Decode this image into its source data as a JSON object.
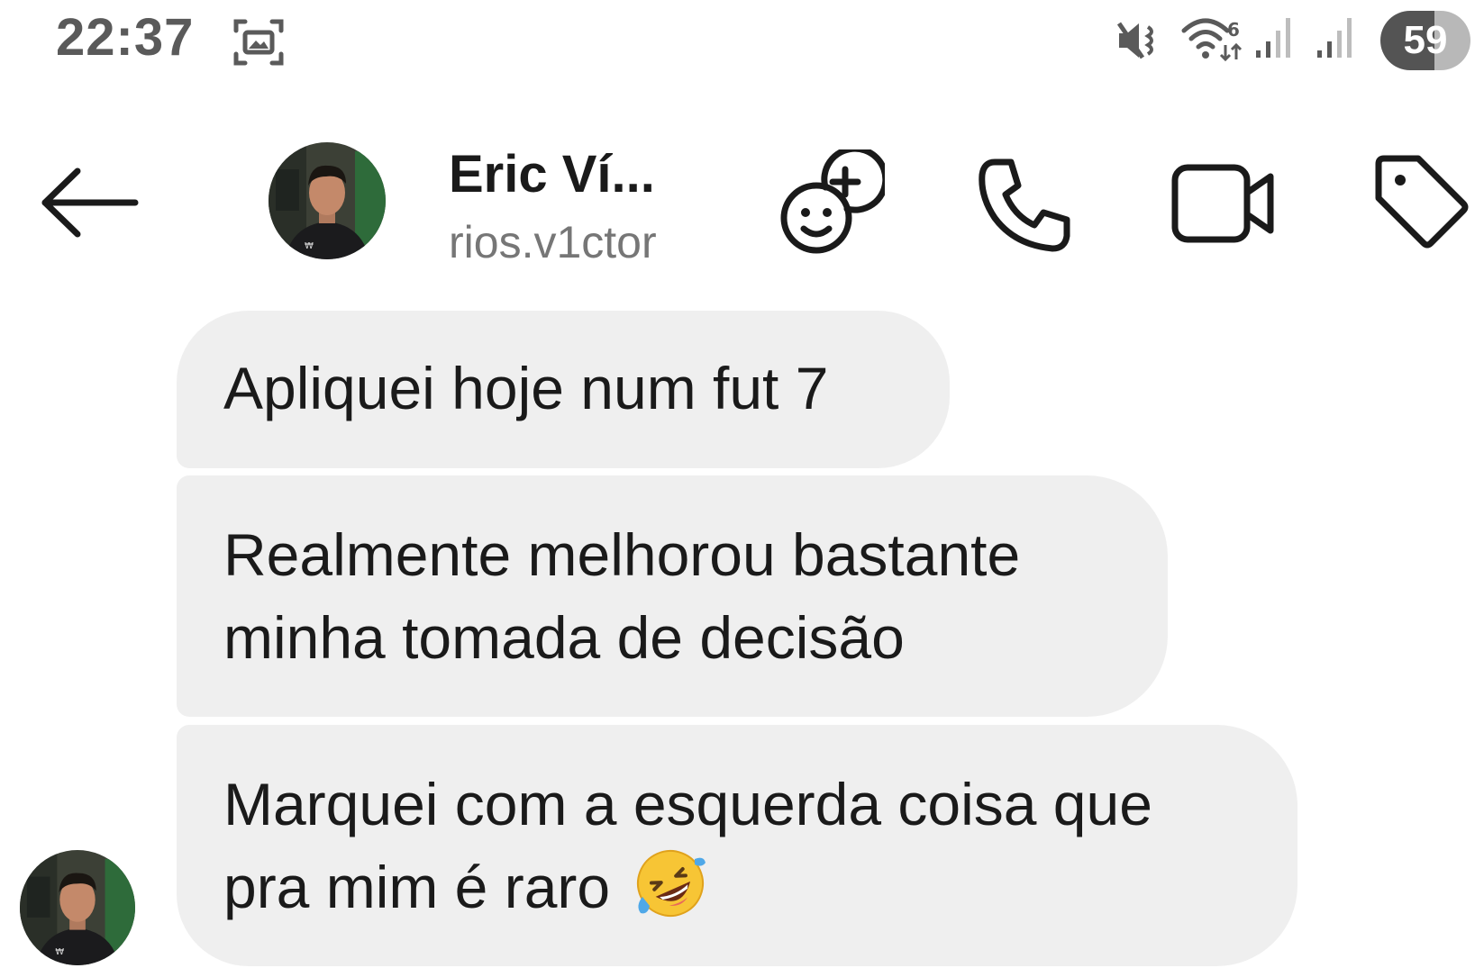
{
  "status_bar": {
    "time": "22:37",
    "battery": "59",
    "icons": [
      "screen-record-icon",
      "mute-icon",
      "wifi-icon",
      "signal-icon",
      "signal-icon"
    ]
  },
  "header": {
    "back_icon": "arrow-left-icon",
    "contact_name": "Eric Ví...",
    "username": "rios.v1ctor",
    "actions": [
      "effects-icon",
      "phone-icon",
      "video-camera-icon",
      "tag-icon"
    ]
  },
  "messages": [
    {
      "lines": [
        "Apliquei hoje num fut 7"
      ]
    },
    {
      "lines": [
        "Realmente melhorou bastante",
        "minha tomada de decisão"
      ]
    },
    {
      "lines": [
        "Marquei com a esquerda coisa que",
        "pra mim é raro"
      ],
      "emoji": "rolling-on-floor-laughing-emoji"
    }
  ],
  "colors": {
    "bubble_bg": "#efefef",
    "text": "#1a1a1a",
    "secondary_text": "#767676",
    "status_text": "#5a5a5a"
  }
}
